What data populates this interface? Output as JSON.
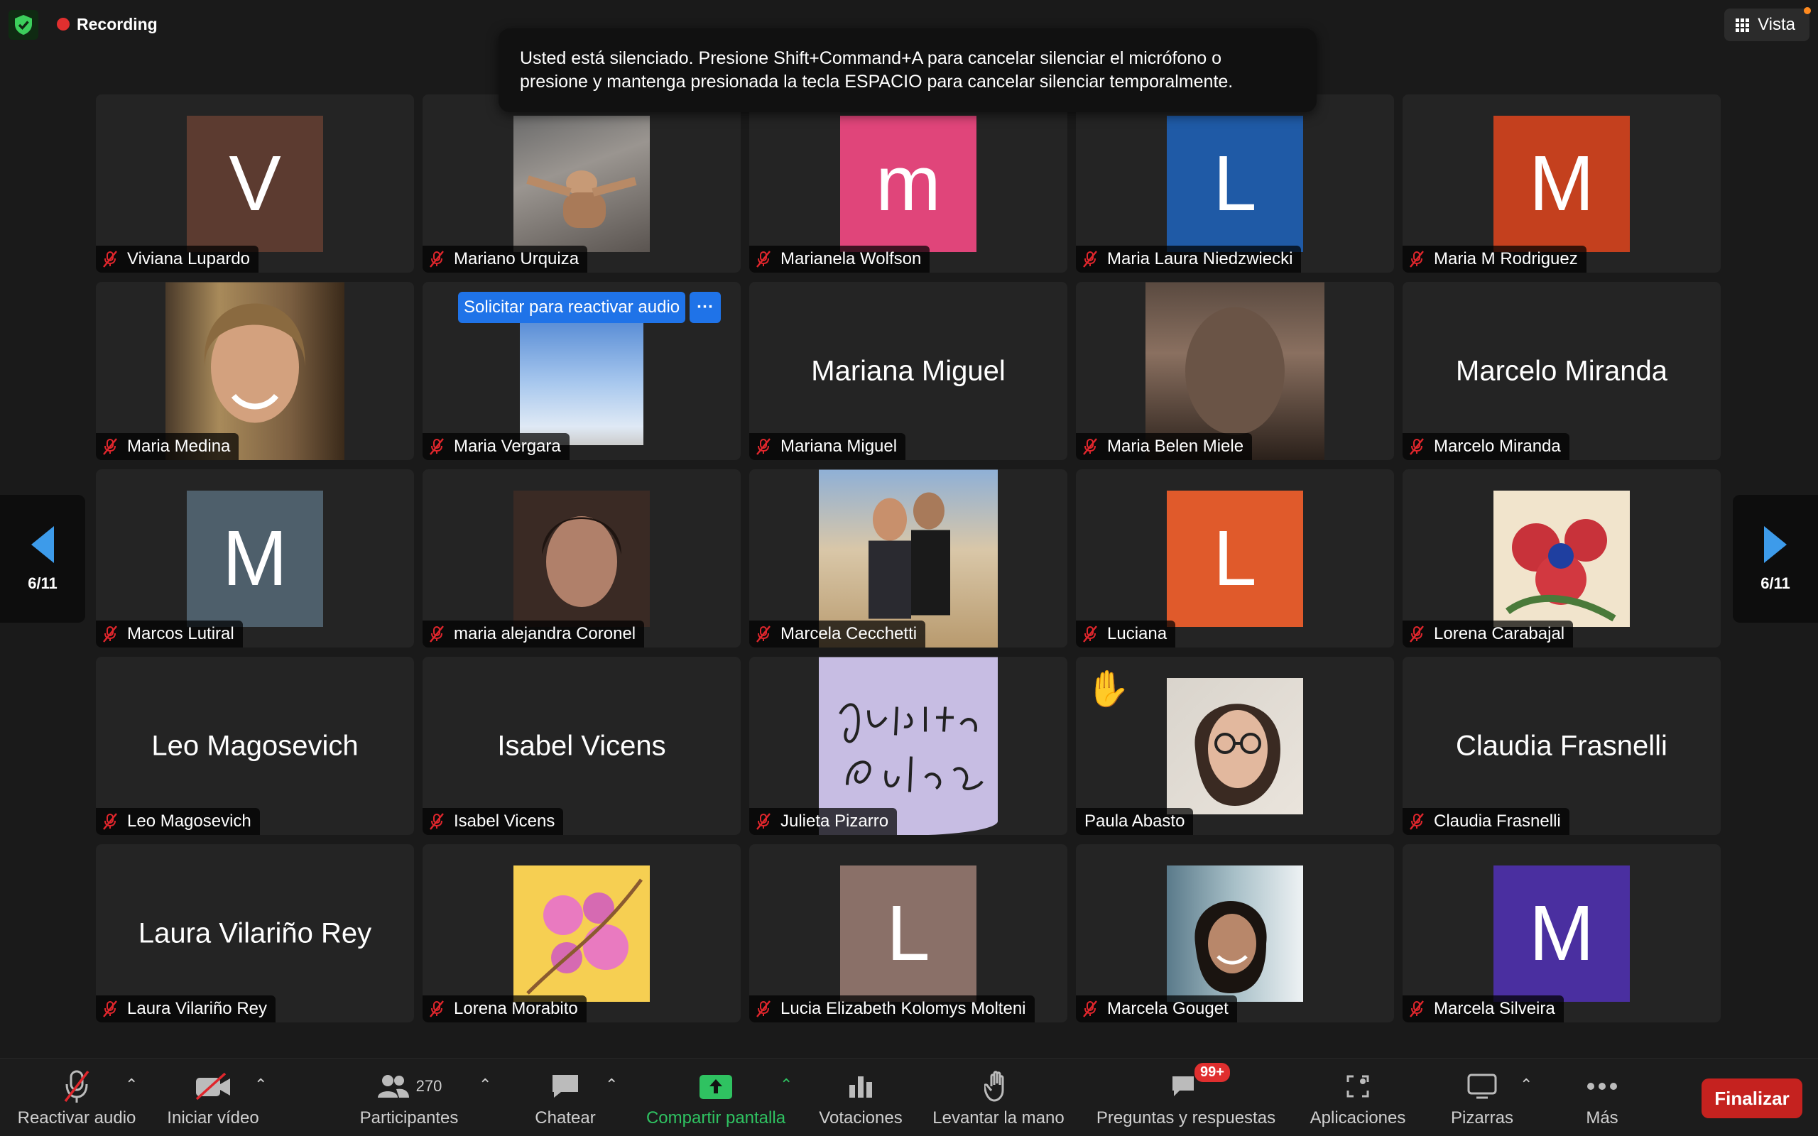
{
  "topbar": {
    "recording_label": "Recording",
    "view_label": "Vista"
  },
  "toast": {
    "line1": "Usted está silenciado. Presione Shift+Command+A para cancelar silenciar el micrófono o",
    "line2": "presione y mantenga presionada la tecla ESPACIO para cancelar silenciar temporalmente."
  },
  "pagination": {
    "left": "6/11",
    "right": "6/11"
  },
  "request": {
    "label": "Solicitar para reactivar audio",
    "more": "···"
  },
  "tiles": [
    {
      "name": "Viviana Lupardo",
      "initial": "V",
      "color": "#5c3b30"
    },
    {
      "name": "Mariano Urquiza"
    },
    {
      "name": "Marianela Wolfson",
      "initial": "m",
      "color": "#e0457a"
    },
    {
      "name": "Maria Laura Niedzwiecki",
      "initial": "L",
      "color": "#1f5aa6"
    },
    {
      "name": "Maria M Rodriguez",
      "initial": "M",
      "color": "#c4401e"
    },
    {
      "name": "Maria Medina"
    },
    {
      "name": "Maria Vergara"
    },
    {
      "name": "Mariana Miguel",
      "center": "Mariana Miguel"
    },
    {
      "name": "Maria Belen Miele"
    },
    {
      "name": "Marcelo Miranda",
      "center": "Marcelo Miranda"
    },
    {
      "name": "Marcos Lutiral",
      "initial": "M",
      "color": "#4e5f6b"
    },
    {
      "name": "maria alejandra Coronel"
    },
    {
      "name": "Marcela Cecchetti"
    },
    {
      "name": "Luciana",
      "initial": "L",
      "color": "#e05a2b"
    },
    {
      "name": "Lorena Carabajal"
    },
    {
      "name": "Leo Magosevich",
      "center": "Leo Magosevich"
    },
    {
      "name": "Isabel Vicens",
      "center": "Isabel Vicens"
    },
    {
      "name": "Julieta Pizarro"
    },
    {
      "name": "Paula Abasto"
    },
    {
      "name": "Claudia Frasnelli",
      "center": "Claudia Frasnelli"
    },
    {
      "name": "Laura Vilariño Rey",
      "center": "Laura Vilariño Rey"
    },
    {
      "name": "Lorena Morabito"
    },
    {
      "name": "Lucia Elizabeth Kolomys Molteni",
      "initial": "L",
      "color": "#8a7068"
    },
    {
      "name": "Marcela Gouget"
    },
    {
      "name": "Marcela Silveira",
      "initial": "M",
      "color": "#4a2fa0"
    }
  ],
  "toolbar": {
    "unmute": "Reactivar audio",
    "video": "Iniciar vídeo",
    "participants": "Participantes",
    "participants_count": "270",
    "chat": "Chatear",
    "share": "Compartir pantalla",
    "polls": "Votaciones",
    "raise_hand": "Levantar la mano",
    "qa": "Preguntas y respuestas",
    "qa_badge": "99+",
    "apps": "Aplicaciones",
    "whiteboards": "Pizarras",
    "more": "Más",
    "end": "Finalizar"
  },
  "colors": {
    "share_green": "#2fc261",
    "end_red": "#c5221f",
    "request_blue": "#1f73e8"
  }
}
